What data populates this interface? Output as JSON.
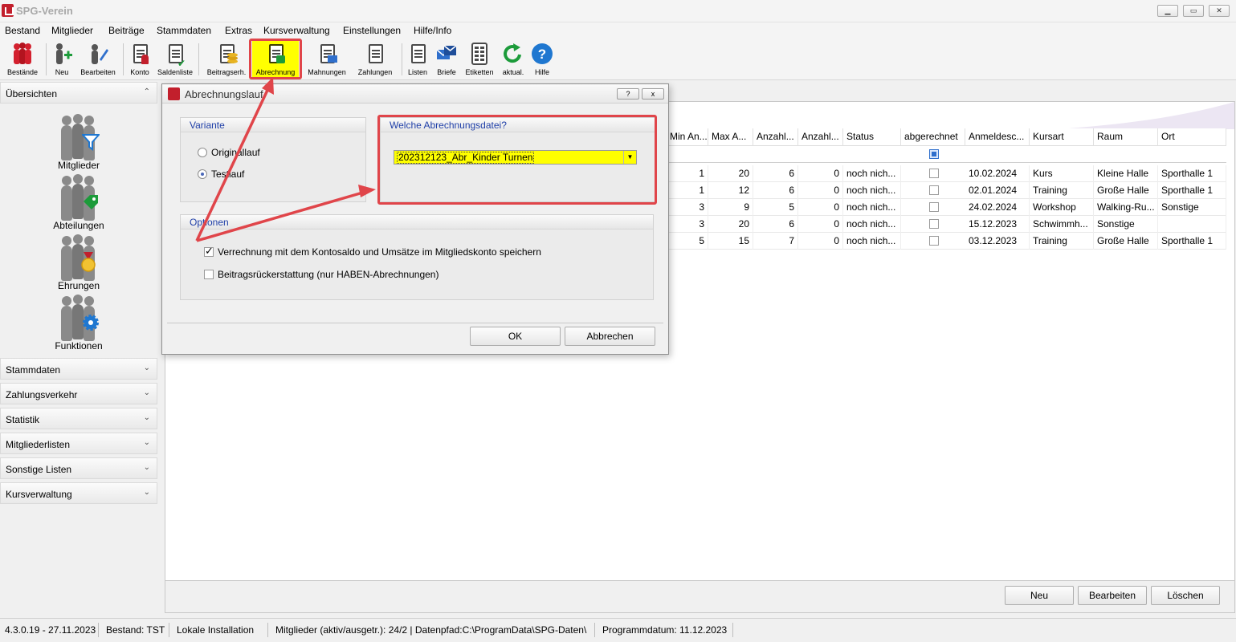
{
  "app": {
    "title": "SPG-Verein"
  },
  "menu": [
    "Bestand",
    "Mitglieder",
    "Beiträge",
    "Stammdaten",
    "Extras",
    "Kursverwaltung",
    "Einstellungen",
    "Hilfe/Info"
  ],
  "toolbar": {
    "bestaende": "Bestände",
    "neu": "Neu",
    "bearbeiten": "Bearbeiten",
    "konto": "Konto",
    "saldenliste": "Saldenliste",
    "beitragserh": "Beitragserh.",
    "abrechnung": "Abrechnung",
    "mahnungen": "Mahnungen",
    "zahlungen": "Zahlungen",
    "listen": "Listen",
    "briefe": "Briefe",
    "etiketten": "Etiketten",
    "aktual": "aktual.",
    "hilfe": "Hilfe"
  },
  "sidebar": {
    "overview_label": "Übersichten",
    "icons": [
      "Mitglieder",
      "Abteilungen",
      "Ehrungen",
      "Funktionen"
    ],
    "sections": [
      "Stammdaten",
      "Zahlungsverkehr",
      "Statistik",
      "Mitgliederlisten",
      "Sonstige Listen",
      "Kursverwaltung"
    ]
  },
  "grid": {
    "columns": [
      "Min An...",
      "Max A...",
      "Anzahl...",
      "Anzahl...",
      "Status",
      "abgerechnet",
      "Anmeldesc...",
      "Kursart",
      "Raum",
      "Ort"
    ],
    "rows": [
      [
        "1",
        "20",
        "6",
        "0",
        "noch nich...",
        "",
        "10.02.2024",
        "Kurs",
        "Kleine Halle",
        "Sporthalle 1"
      ],
      [
        "1",
        "12",
        "6",
        "0",
        "noch nich...",
        "",
        "02.01.2024",
        "Training",
        "Große Halle",
        "Sporthalle 1"
      ],
      [
        "3",
        "9",
        "5",
        "0",
        "noch nich...",
        "",
        "24.02.2024",
        "Workshop",
        "Walking-Ru...",
        "Sonstige"
      ],
      [
        "3",
        "20",
        "6",
        "0",
        "noch nich...",
        "",
        "15.12.2023",
        "Schwimmh...",
        "Sonstige"
      ],
      [
        "5",
        "15",
        "7",
        "0",
        "noch nich...",
        "",
        "03.12.2023",
        "Training",
        "Große Halle",
        "Sporthalle 1"
      ]
    ]
  },
  "main_buttons": {
    "neu": "Neu",
    "bearbeiten": "Bearbeiten",
    "loeschen": "Löschen"
  },
  "dialog": {
    "title": "Abrechnungslauf",
    "help_btn": "?",
    "close_btn": "x",
    "variante_header": "Variante",
    "variante_options": [
      "Originallauf",
      "Testlauf"
    ],
    "file_header": "Welche Abrechnungsdatei?",
    "file_value": "202312123_Abr_Kinder Turnen",
    "optionen_header": "Optionen",
    "option1": "Verrechnung mit dem Kontosaldo und Umsätze im Mitgliedskonto speichern",
    "option2": "Beitragsrückerstattung (nur HABEN-Abrechnungen)",
    "ok": "OK",
    "cancel": "Abbrechen"
  },
  "status": {
    "version": "4.3.0.19 - 27.11.2023",
    "bestand": "Bestand: TST",
    "installation": "Lokale Installation",
    "mitglieder": "Mitglieder (aktiv/ausgetr.): 24/2 | Datenpfad:C:\\ProgramData\\SPG-Daten\\",
    "programmdatum": "Programmdatum: 11.12.2023"
  },
  "colors": {
    "highlight": "#ffff00",
    "annotation": "#e0454a",
    "brand": "#c21f2c",
    "group_header_text": "#1f3fa8"
  }
}
